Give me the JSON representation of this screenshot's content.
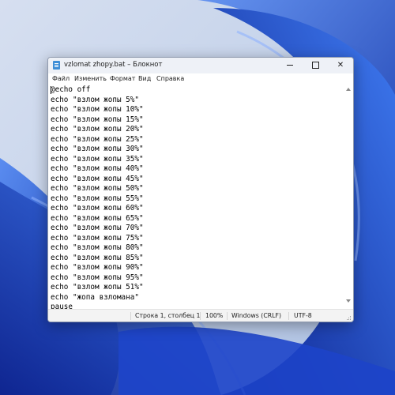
{
  "window": {
    "title": "vzlomat zhopy.bat – Блокнот",
    "app_icon": "notepad-icon",
    "accent_color": "#3f8fd7"
  },
  "menu": {
    "items": [
      "Файл",
      "Изменить",
      "Формат",
      "Вид",
      "Справка"
    ]
  },
  "editor": {
    "lines": [
      "@echo off",
      "echo \"взлом жопы 5%\"",
      "echo \"взлом жопы 10%\"",
      "echo \"взлом жопы 15%\"",
      "echo \"взлом жопы 20%\"",
      "echo \"взлом жопы 25%\"",
      "echo \"взлом жопы 30%\"",
      "echo \"взлом жопы 35%\"",
      "echo \"взлом жопы 40%\"",
      "echo \"взлом жопы 45%\"",
      "echo \"взлом жопы 50%\"",
      "echo \"взлом жопы 55%\"",
      "echo \"взлом жопы 60%\"",
      "echo \"взлом жопы 65%\"",
      "echo \"взлом жопы 70%\"",
      "echo \"взлом жопы 75%\"",
      "echo \"взлом жопы 80%\"",
      "echo \"взлом жопы 85%\"",
      "echo \"взлом жопы 90%\"",
      "echo \"взлом жопы 95%\"",
      "echo \"взлом жопы 51%\"",
      "echo \"жопа взломана\"",
      "pause"
    ]
  },
  "status": {
    "position": "Строка 1, столбец 1",
    "zoom": "100%",
    "line_endings": "Windows (CRLF)",
    "encoding": "UTF-8"
  }
}
